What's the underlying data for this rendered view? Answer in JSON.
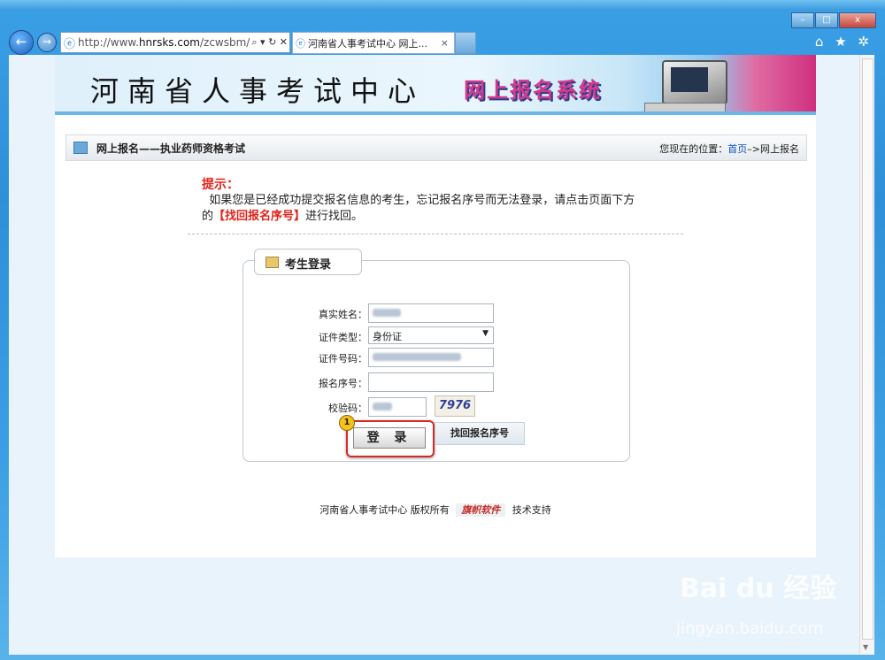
{
  "window": {
    "minimize": "–",
    "maximize": "□",
    "close": "x"
  },
  "browser": {
    "address_prefix": "http://www.",
    "address_domain": "hnrsks.com",
    "address_suffix": "/zcwsbm/",
    "tab_title": "河南省人事考试中心 网上...",
    "tab_close": "×",
    "address_controls": "⌕ ▾ ↻ ✕",
    "home_icon": "⌂",
    "favorites_icon": "★",
    "tools_icon": "✲"
  },
  "banner": {
    "title": "河南省人事考试中心",
    "system_name": "网上报名系统"
  },
  "crumb": {
    "section": "网上报名——执业药师资格考试",
    "location_prefix": "您现在的位置：",
    "home_link": "首页",
    "location_suffix": "–>网上报名"
  },
  "tip": {
    "heading": "提示：",
    "line1": "如果您是已经成功提交报名信息的考生，忘记报名序号而无法登录，请点击页面下方",
    "line2_prefix": "的",
    "line2_link": "【找回报名序号】",
    "line2_suffix": "进行找回。"
  },
  "login": {
    "tab_label": "考生登录",
    "name_label": "真实姓名：",
    "id_type_label": "证件类型：",
    "id_type_value": "身份证",
    "id_number_label": "证件号码：",
    "reg_no_label": "报名序号：",
    "captcha_label": "校验码：",
    "captcha_text": "7976",
    "login_button": "登 录",
    "retrieve_button": "找回报名序号",
    "step_badge": "1"
  },
  "footer": {
    "text": "河南省人事考试中心 版权所有",
    "logo_text": "旗帜软件",
    "support": "技术支持"
  },
  "watermark": {
    "brand": "Bai du 经验",
    "url": "jingyan.baidu.com"
  }
}
